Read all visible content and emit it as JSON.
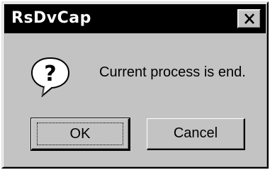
{
  "window": {
    "title": "RsDvCap"
  },
  "titlebar": {
    "close_icon": "close-x-icon"
  },
  "dialog": {
    "icon": "question-balloon-icon",
    "message": "Current process is end.",
    "icon_glyph": "?"
  },
  "buttons": {
    "ok_label": "OK",
    "cancel_label": "Cancel"
  },
  "colors": {
    "face": "#c3c3c3",
    "titlebar": "#000000",
    "title_text": "#ffffff"
  }
}
